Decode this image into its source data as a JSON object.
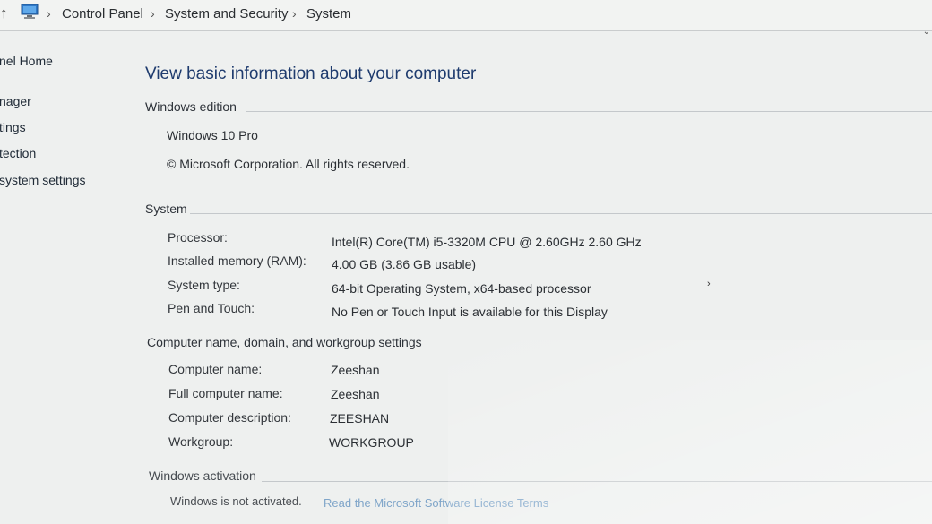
{
  "address_bar": {
    "up_icon": "up-arrow-icon",
    "location_icon": "computer-icon",
    "breadcrumbs": [
      "Control Panel",
      "System and Security",
      "System"
    ],
    "separator": "›"
  },
  "sidebar": {
    "items": [
      {
        "label": "nel Home"
      },
      {
        "label": "nager"
      },
      {
        "label": "tings"
      },
      {
        "label": "tection"
      },
      {
        "label": "system settings"
      }
    ]
  },
  "main": {
    "title": "View basic information about your computer",
    "windows_edition": {
      "heading": "Windows edition",
      "edition": "Windows 10 Pro",
      "copyright": "© Microsoft Corporation. All rights reserved."
    },
    "system": {
      "heading": "System",
      "rows": [
        {
          "label": "Processor:",
          "value": "Intel(R) Core(TM) i5-3320M CPU @ 2.60GHz   2.60 GHz"
        },
        {
          "label": "Installed memory (RAM):",
          "value": "4.00 GB (3.86 GB usable)"
        },
        {
          "label": "System type:",
          "value": "64-bit Operating System, x64-based processor"
        },
        {
          "label": "Pen and Touch:",
          "value": "No Pen or Touch Input is available for this Display"
        }
      ]
    },
    "computer_name": {
      "heading": "Computer name, domain, and workgroup settings",
      "rows": [
        {
          "label": "Computer name:",
          "value": "Zeeshan"
        },
        {
          "label": "Full computer name:",
          "value": "Zeeshan"
        },
        {
          "label": "Computer description:",
          "value": "ZEESHAN"
        },
        {
          "label": "Workgroup:",
          "value": "WORKGROUP"
        }
      ]
    },
    "activation": {
      "heading": "Windows activation",
      "status": "Windows is not activated.",
      "link": "Read the Microsoft Software License Terms"
    }
  },
  "colors": {
    "title": "#1e3b6e",
    "link": "#7fa5c9",
    "background": "#eef0ef"
  }
}
